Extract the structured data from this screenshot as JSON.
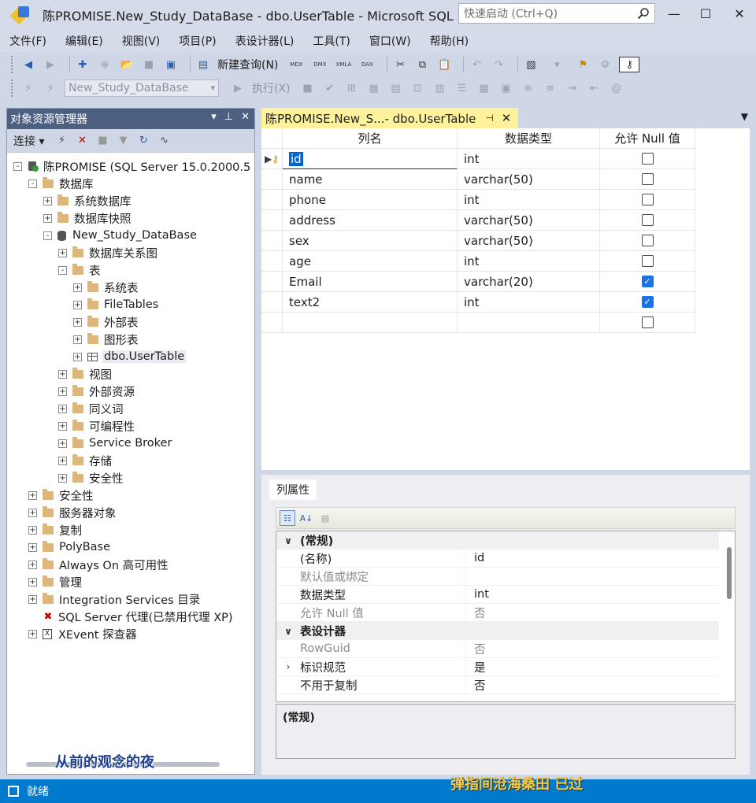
{
  "window": {
    "title": "陈PROMISE.New_Study_DataBase - dbo.UserTable - Microsoft SQL Ser...",
    "quick_launch_placeholder": "快速启动 (Ctrl+Q)"
  },
  "menu": [
    "文件(F)",
    "编辑(E)",
    "视图(V)",
    "项目(P)",
    "表设计器(L)",
    "工具(T)",
    "窗口(W)",
    "帮助(H)"
  ],
  "toolbar": {
    "new_query": "新建查询(N)",
    "database_select": "New_Study_DataBase",
    "execute": "执行(X)",
    "icon_labels": [
      "MDX",
      "DMX",
      "XMLA",
      "DAX"
    ]
  },
  "object_explorer": {
    "title": "对象资源管理器",
    "connect_label": "连接",
    "tree": [
      {
        "label": "陈PROMISE (SQL Server 15.0.2000.5 -",
        "level": 0,
        "expander": "-",
        "icon": "server"
      },
      {
        "label": "数据库",
        "level": 1,
        "expander": "-",
        "icon": "folder"
      },
      {
        "label": "系统数据库",
        "level": 2,
        "expander": "+",
        "icon": "folder"
      },
      {
        "label": "数据库快照",
        "level": 2,
        "expander": "+",
        "icon": "folder"
      },
      {
        "label": "New_Study_DataBase",
        "level": 2,
        "expander": "-",
        "icon": "database"
      },
      {
        "label": "数据库关系图",
        "level": 3,
        "expander": "+",
        "icon": "folder"
      },
      {
        "label": "表",
        "level": 3,
        "expander": "-",
        "icon": "folder"
      },
      {
        "label": "系统表",
        "level": 4,
        "expander": "+",
        "icon": "folder"
      },
      {
        "label": "FileTables",
        "level": 4,
        "expander": "+",
        "icon": "folder"
      },
      {
        "label": "外部表",
        "level": 4,
        "expander": "+",
        "icon": "folder"
      },
      {
        "label": "图形表",
        "level": 4,
        "expander": "+",
        "icon": "folder"
      },
      {
        "label": "dbo.UserTable",
        "level": 4,
        "expander": "+",
        "icon": "table",
        "selected": true
      },
      {
        "label": "视图",
        "level": 3,
        "expander": "+",
        "icon": "folder"
      },
      {
        "label": "外部资源",
        "level": 3,
        "expander": "+",
        "icon": "folder"
      },
      {
        "label": "同义词",
        "level": 3,
        "expander": "+",
        "icon": "folder"
      },
      {
        "label": "可编程性",
        "level": 3,
        "expander": "+",
        "icon": "folder"
      },
      {
        "label": "Service Broker",
        "level": 3,
        "expander": "+",
        "icon": "folder"
      },
      {
        "label": "存储",
        "level": 3,
        "expander": "+",
        "icon": "folder"
      },
      {
        "label": "安全性",
        "level": 3,
        "expander": "+",
        "icon": "folder"
      },
      {
        "label": "安全性",
        "level": 1,
        "expander": "+",
        "icon": "folder"
      },
      {
        "label": "服务器对象",
        "level": 1,
        "expander": "+",
        "icon": "folder"
      },
      {
        "label": "复制",
        "level": 1,
        "expander": "+",
        "icon": "folder"
      },
      {
        "label": "PolyBase",
        "level": 1,
        "expander": "+",
        "icon": "folder"
      },
      {
        "label": "Always On 高可用性",
        "level": 1,
        "expander": "+",
        "icon": "folder"
      },
      {
        "label": "管理",
        "level": 1,
        "expander": "+",
        "icon": "folder"
      },
      {
        "label": "Integration Services 目录",
        "level": 1,
        "expander": "+",
        "icon": "folder"
      },
      {
        "label": "SQL Server 代理(已禁用代理 XP)",
        "level": 1,
        "expander": "",
        "icon": "agent"
      },
      {
        "label": "XEvent 探查器",
        "level": 1,
        "expander": "+",
        "icon": "xevent"
      }
    ]
  },
  "document_tab": {
    "label": "陈PROMISE.New_S...- dbo.UserTable"
  },
  "designer": {
    "headers": [
      "列名",
      "数据类型",
      "允许 Null 值"
    ],
    "rows": [
      {
        "name": "id",
        "type": "int",
        "nullable": false,
        "primary_key": true
      },
      {
        "name": "name",
        "type": "varchar(50)",
        "nullable": false
      },
      {
        "name": "phone",
        "type": "int",
        "nullable": false
      },
      {
        "name": "address",
        "type": "varchar(50)",
        "nullable": false
      },
      {
        "name": "sex",
        "type": "varchar(50)",
        "nullable": false
      },
      {
        "name": "age",
        "type": "int",
        "nullable": false
      },
      {
        "name": "Email",
        "type": "varchar(20)",
        "nullable": true
      },
      {
        "name": "text2",
        "type": "int",
        "nullable": true
      },
      {
        "name": "",
        "type": "",
        "nullable": false
      }
    ]
  },
  "properties": {
    "tab_label": "列属性",
    "rows": [
      {
        "kind": "category",
        "name": "(常规)",
        "gutter": "∨"
      },
      {
        "kind": "prop",
        "name": "(名称)",
        "value": "id"
      },
      {
        "kind": "prop",
        "name": "默认值或绑定",
        "value": "",
        "dim": true
      },
      {
        "kind": "prop",
        "name": "数据类型",
        "value": "int"
      },
      {
        "kind": "prop",
        "name": "允许 Null 值",
        "value": "否",
        "dim": true
      },
      {
        "kind": "category",
        "name": "表设计器",
        "gutter": "∨"
      },
      {
        "kind": "prop",
        "name": "RowGuid",
        "value": "否",
        "dim": true
      },
      {
        "kind": "prop",
        "name": "标识规范",
        "value": "是",
        "gutter": "›"
      },
      {
        "kind": "prop",
        "name": "不用于复制",
        "value": "否"
      }
    ],
    "description_title": "(常规)"
  },
  "status": {
    "text": "就绪"
  },
  "captions": {
    "left": "从前的观念的夜",
    "right": "弹指间沧海桑田 已过"
  }
}
